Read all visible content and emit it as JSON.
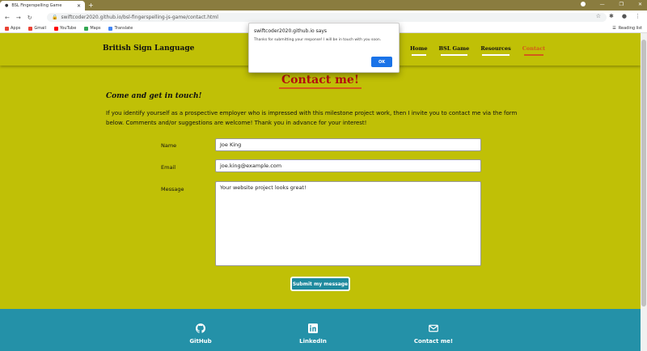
{
  "browser": {
    "tab_title": "BSL Fingerspelling Game",
    "url": "swiftcoder2020.github.io/bsl-fingerspelling-js-game/contact.html",
    "bookmarks": [
      {
        "label": "Apps",
        "color": "#ea4335"
      },
      {
        "label": "Gmail",
        "color": "#ea4335"
      },
      {
        "label": "YouTube",
        "color": "#ff0000"
      },
      {
        "label": "Maps",
        "color": "#34a853"
      },
      {
        "label": "Translate",
        "color": "#4285f4"
      }
    ],
    "reading_list": "Reading list"
  },
  "nav": {
    "brand": "British Sign Language",
    "links": [
      "Home",
      "BSL Game",
      "Resources",
      "Contact"
    ]
  },
  "main": {
    "heading": "Contact me!",
    "subheading": "Come and get in touch!",
    "intro": "If you identify yourself as a prospective employer who is impressed with this milestone project work, then I invite you to contact me via the form below. Comments and/or suggestions are welcome! Thank you in advance for your interest!"
  },
  "form": {
    "name_label": "Name",
    "name_value": "Joe King",
    "email_label": "Email",
    "email_value": "joe.king@example.com",
    "message_label": "Message",
    "message_value": "Your website project looks great!",
    "submit_label": "Submit my message"
  },
  "footer": {
    "github": "GitHub",
    "linkedin": "LinkedIn",
    "contact": "Contact me!"
  },
  "dialog": {
    "title": "swiftcoder2020.github.io says",
    "message": "Thanks for submitting your response! I will be in touch with you soon.",
    "ok": "OK"
  },
  "colors": {
    "page_bg": "#c0c006",
    "accent": "#d35a1b",
    "heading": "#b50f0f",
    "footer": "#2491a8",
    "button": "#1e8a9e"
  }
}
